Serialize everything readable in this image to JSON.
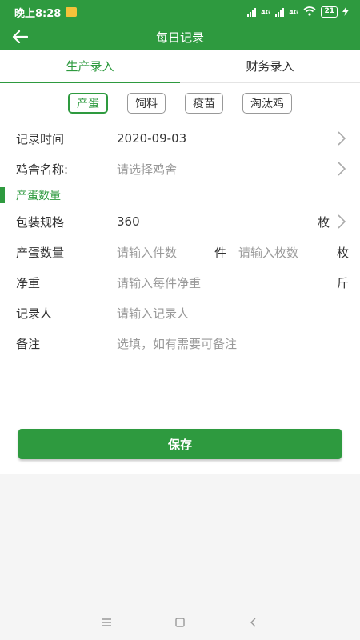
{
  "status_bar": {
    "time": "晚上8:28",
    "signal1": "4G",
    "signal2": "4G",
    "battery": "21"
  },
  "app_bar": {
    "title": "每日记录",
    "back_icon": "arrow-left-icon"
  },
  "tabs": [
    {
      "label": "生产录入",
      "active": true
    },
    {
      "label": "财务录入",
      "active": false
    }
  ],
  "chips": [
    {
      "label": "产蛋",
      "active": true
    },
    {
      "label": "饲料",
      "active": false
    },
    {
      "label": "疫苗",
      "active": false
    },
    {
      "label": "淘汰鸡",
      "active": false
    }
  ],
  "form": {
    "record_time": {
      "label": "记录时间",
      "value": "2020-09-03"
    },
    "coop": {
      "label": "鸡舍名称:",
      "placeholder": "请选择鸡舍"
    },
    "section_title": "产蛋数量",
    "package_spec": {
      "label": "包装规格",
      "value": "360",
      "unit": "枚"
    },
    "egg_qty": {
      "label": "产蛋数量",
      "pieces_placeholder": "请输入件数",
      "pieces_unit": "件",
      "count_placeholder": "请输入枚数",
      "count_unit": "枚"
    },
    "net_weight": {
      "label": "净重",
      "placeholder": "请输入每件净重",
      "unit": "斤"
    },
    "recorder": {
      "label": "记录人",
      "placeholder": "请输入记录人"
    },
    "remark": {
      "label": "备注",
      "placeholder": "选填，如有需要可备注"
    }
  },
  "save_label": "保存",
  "colors": {
    "primary": "#2e9a3f",
    "placeholder": "#999999"
  }
}
